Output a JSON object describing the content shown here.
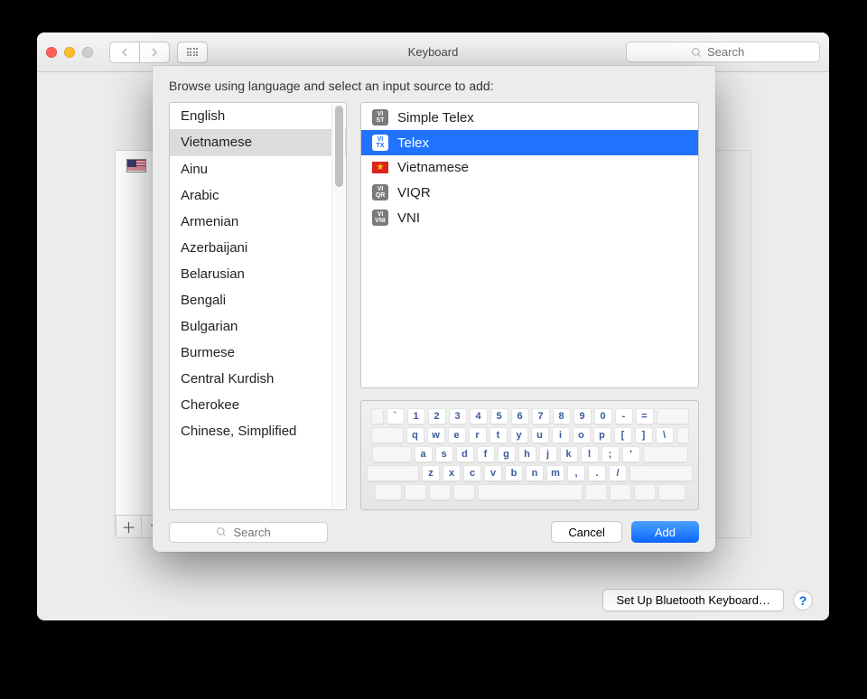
{
  "window": {
    "title": "Keyboard",
    "search_placeholder": "Search"
  },
  "panel": {
    "sidebar_items": [
      "U.S."
    ],
    "bluetooth_button": "Set Up Bluetooth Keyboard…",
    "help_label": "?"
  },
  "sheet": {
    "title": "Browse using language and select an input source to add:",
    "search_placeholder": "Search",
    "cancel_label": "Cancel",
    "add_label": "Add",
    "selected_language_index": 1,
    "languages": [
      "English",
      "Vietnamese",
      "Ainu",
      "Arabic",
      "Armenian",
      "Azerbaijani",
      "Belarusian",
      "Bengali",
      "Bulgarian",
      "Burmese",
      "Central Kurdish",
      "Cherokee",
      "Chinese, Simplified"
    ],
    "selected_source_index": 1,
    "sources": [
      {
        "label": "Simple Telex",
        "icon": "VI ST"
      },
      {
        "label": "Telex",
        "icon": "VI TX"
      },
      {
        "label": "Vietnamese",
        "icon": "flag-vn"
      },
      {
        "label": "VIQR",
        "icon": "VI QR"
      },
      {
        "label": "VNI",
        "icon": "VI VNI"
      }
    ],
    "keyboard_rows": [
      [
        "`",
        "1",
        "2",
        "3",
        "4",
        "5",
        "6",
        "7",
        "8",
        "9",
        "0",
        "-",
        "="
      ],
      [
        "q",
        "w",
        "e",
        "r",
        "t",
        "y",
        "u",
        "i",
        "o",
        "p",
        "[",
        "]",
        "\\"
      ],
      [
        "a",
        "s",
        "d",
        "f",
        "g",
        "h",
        "j",
        "k",
        "l",
        ";",
        "'"
      ],
      [
        "z",
        "x",
        "c",
        "v",
        "b",
        "n",
        "m",
        ",",
        ".",
        "/"
      ]
    ]
  }
}
